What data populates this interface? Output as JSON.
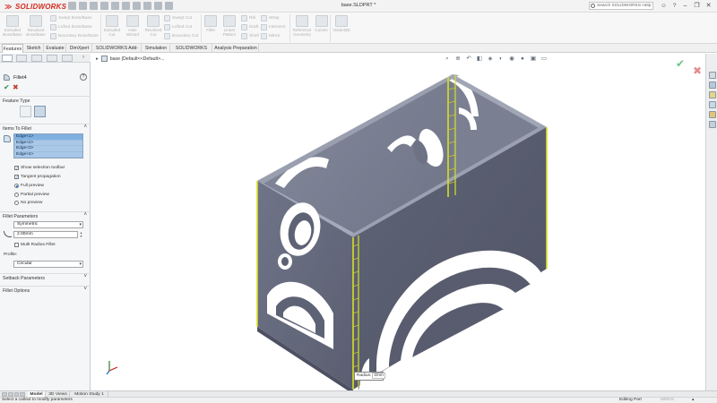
{
  "app": {
    "logo_text": "SOLIDWORKS",
    "document_title": "base.SLDPRT *",
    "search_placeholder": "Search SOLIDWORKS Help"
  },
  "ribbon": {
    "items": {
      "extruded_boss": "Extruded Boss/Base",
      "revolved_boss": "Revolved Boss/Base",
      "swept_boss": "Swept Boss/Base",
      "lofted_boss": "Lofted Boss/Base",
      "boundary_boss": "Boundary Boss/Base",
      "extruded_cut": "Extruded Cut",
      "hole_wizard": "Hole Wizard",
      "revolved_cut": "Revolved Cut",
      "swept_cut": "Swept Cut",
      "lofted_cut": "Lofted Cut",
      "boundary_cut": "Boundary Cut",
      "fillet": "Fillet",
      "linear_pattern": "Linear Pattern",
      "rib": "Rib",
      "draft": "Draft",
      "shell": "Shell",
      "wrap": "Wrap",
      "intersect": "Intersect",
      "mirror": "Mirror",
      "reference_geometry": "Reference Geometry",
      "curves": "Curves",
      "instant3d": "Instant3D"
    }
  },
  "command_tabs": [
    "Features",
    "Sketch",
    "Evaluate",
    "DimXpert",
    "SOLIDWORKS Add-Ins",
    "Simulation",
    "SOLIDWORKS MBD",
    "Analysis Preparation"
  ],
  "property_manager": {
    "feature_name": "Fillet4",
    "help_glyph": "?",
    "ok_glyph": "✔",
    "cancel_glyph": "✖",
    "feature_type": {
      "title": "Feature Type"
    },
    "items_to_fillet": {
      "title": "Items To Fillet",
      "edges": [
        "Edge<1>",
        "Edge<2>",
        "Edge<3>",
        "Edge<4>"
      ],
      "show_selection_toolbar": "Show selection toolbar",
      "tangent_propagation": "Tangent propagation",
      "full_preview": "Full preview",
      "partial_preview": "Partial preview",
      "no_preview": "No preview"
    },
    "fillet_parameters": {
      "title": "Fillet Parameters",
      "method": "Symmetric",
      "radius": "2.00mm",
      "multi_radius": "Multi Radius Fillet",
      "profile_label": "Profile:",
      "profile": "Circular"
    },
    "setback_parameters": {
      "title": "Setback Parameters"
    },
    "fillet_options": {
      "title": "Fillet Options"
    }
  },
  "viewport": {
    "tree_label": "base (Default<<Default>...",
    "callout_label": "Radius:",
    "callout_value": "2mm",
    "confirm_ok": "✔",
    "confirm_cancel": "✖"
  },
  "bottom_tabs": [
    "Model",
    "3D Views",
    "Motion Study 1"
  ],
  "status": {
    "hint": "Select a callout to modify parameters",
    "mode": "Editing Part",
    "units": "MMGS",
    "arrow": "▴"
  },
  "colors": {
    "model_face": "#6a6f82",
    "model_top": "#7d8296",
    "selected_edge": "#d9e021",
    "brand_red": "#d52b1e",
    "selection_blue": "#a9c8e8"
  }
}
